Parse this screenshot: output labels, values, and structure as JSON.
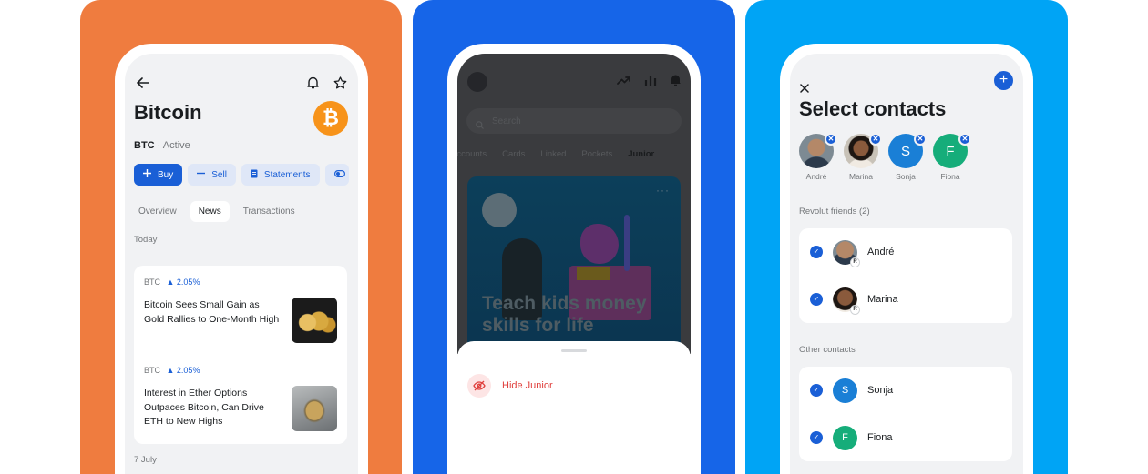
{
  "colors": {
    "panel_1": "#ef7c3f",
    "panel_2": "#1665e8",
    "panel_3": "#00a4f5",
    "accent_blue": "#1a5fd6",
    "danger_red": "#e0413e",
    "bitcoin_orange": "#f7931a"
  },
  "screen1": {
    "back_icon": "arrow-left-icon",
    "title": "Bitcoin",
    "ticker": "BTC",
    "separator": "·",
    "status": "Active",
    "logo_glyph": "₿",
    "actions": [
      {
        "label": "Buy",
        "icon": "plus-icon"
      },
      {
        "label": "Sell",
        "icon": "minus-icon"
      },
      {
        "label": "Statements",
        "icon": "document-icon"
      }
    ],
    "tabs": [
      "Overview",
      "News",
      "Transactions"
    ],
    "active_tab": "News",
    "section_today": "Today",
    "news": [
      {
        "tag": "BTC",
        "change": "▲ 2.05%",
        "headline": "Bitcoin Sees Small Gain as Gold Rallies to One-Month High"
      },
      {
        "tag": "BTC",
        "change": "▲ 2.05%",
        "headline": "Interest in Ether Options Outpaces Bitcoin, Can Drive ETH to New Highs"
      }
    ],
    "section_next": "7 July"
  },
  "screen2": {
    "search_placeholder": "Search",
    "tabs": [
      "Accounts",
      "Cards",
      "Linked",
      "Pockets",
      "Junior"
    ],
    "active_tab": "Junior",
    "hero_more": "···",
    "hero_headline_line1": "Teach kids money",
    "hero_headline_line2": "skills for life",
    "sheet_action": "Hide Junior"
  },
  "screen3": {
    "title": "Select contacts",
    "selected": [
      {
        "name": "André",
        "initial": ""
      },
      {
        "name": "Marina",
        "initial": ""
      },
      {
        "name": "Sonja",
        "initial": "S"
      },
      {
        "name": "Fiona",
        "initial": "F"
      }
    ],
    "remove_glyph": "✕",
    "friends_label": "Revolut friends (2)",
    "friends": [
      {
        "name": "André",
        "badge": "R"
      },
      {
        "name": "Marina",
        "badge": "R"
      }
    ],
    "other_label": "Other contacts",
    "others": [
      {
        "name": "Sonja",
        "initial": "S"
      },
      {
        "name": "Fiona",
        "initial": "F"
      }
    ],
    "check_glyph": "✓",
    "plus_glyph": "+"
  }
}
